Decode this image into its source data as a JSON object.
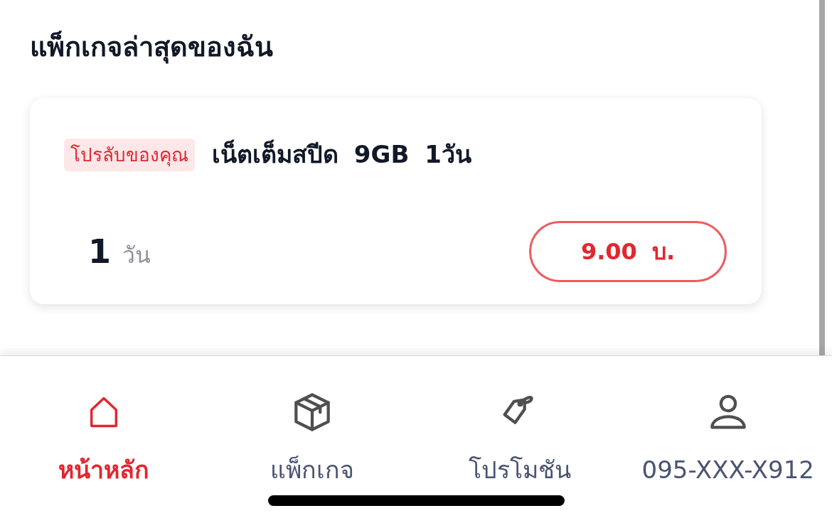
{
  "section_title": "แพ็กเกจล่าสุดของฉัน",
  "packages": [
    {
      "badge": "โปรลับของคุณ",
      "name": "เน็ตเต็มสปีด 9GB 1วัน",
      "duration_value": "1",
      "duration_unit": "วัน",
      "price": "9.00 บ."
    }
  ],
  "bottom_nav": [
    {
      "kind": "home",
      "label": "หน้าหลัก",
      "selected": true
    },
    {
      "kind": "package",
      "label": "แพ็กเกจ",
      "selected": false
    },
    {
      "kind": "promotion",
      "label": "โปรโมชัน",
      "selected": false
    },
    {
      "kind": "account",
      "label": "095-XXX-X912",
      "selected": false
    }
  ]
}
